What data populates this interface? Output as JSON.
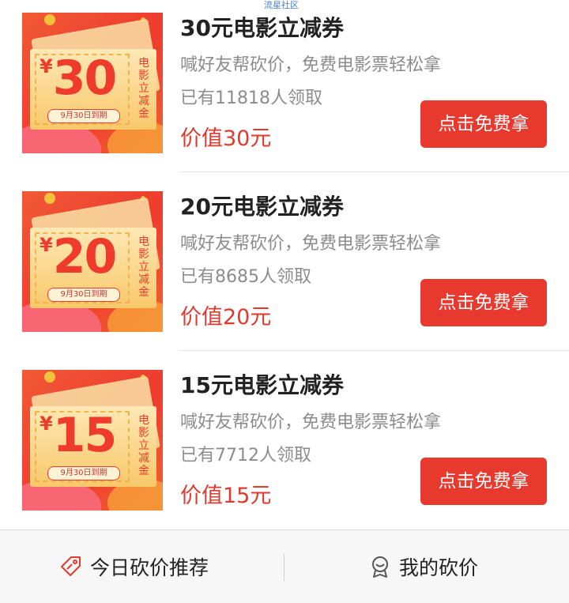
{
  "watermark": "流星社区",
  "coupons": [
    {
      "thumb_amount": "30",
      "thumb_currency": "¥",
      "thumb_side_text": "电影立减金",
      "thumb_expiry": "9月30日到期",
      "title": "30元电影立减券",
      "desc": "喊好友帮砍价，免费电影票轻松拿",
      "count": "已有11818人领取",
      "price": "价值30元",
      "button": "点击免费拿"
    },
    {
      "thumb_amount": "20",
      "thumb_currency": "¥",
      "thumb_side_text": "电影立减金",
      "thumb_expiry": "9月30日到期",
      "title": "20元电影立减券",
      "desc": "喊好友帮砍价，免费电影票轻松拿",
      "count": "已有8685人领取",
      "price": "价值20元",
      "button": "点击免费拿"
    },
    {
      "thumb_amount": "15",
      "thumb_currency": "¥",
      "thumb_side_text": "电影立减金",
      "thumb_expiry": "9月30日到期",
      "title": "15元电影立减券",
      "desc": "喊好友帮砍价，免费电影票轻松拿",
      "count": "已有7712人领取",
      "price": "价值15元",
      "button": "点击免费拿"
    }
  ],
  "bottom_nav": {
    "left": {
      "label": "今日砍价推荐",
      "icon": "tag-icon"
    },
    "right": {
      "label": "我的砍价",
      "icon": "badge-icon"
    }
  },
  "colors": {
    "accent": "#e8392e",
    "price": "#e03a2e",
    "muted_text": "#8c8c8c"
  }
}
